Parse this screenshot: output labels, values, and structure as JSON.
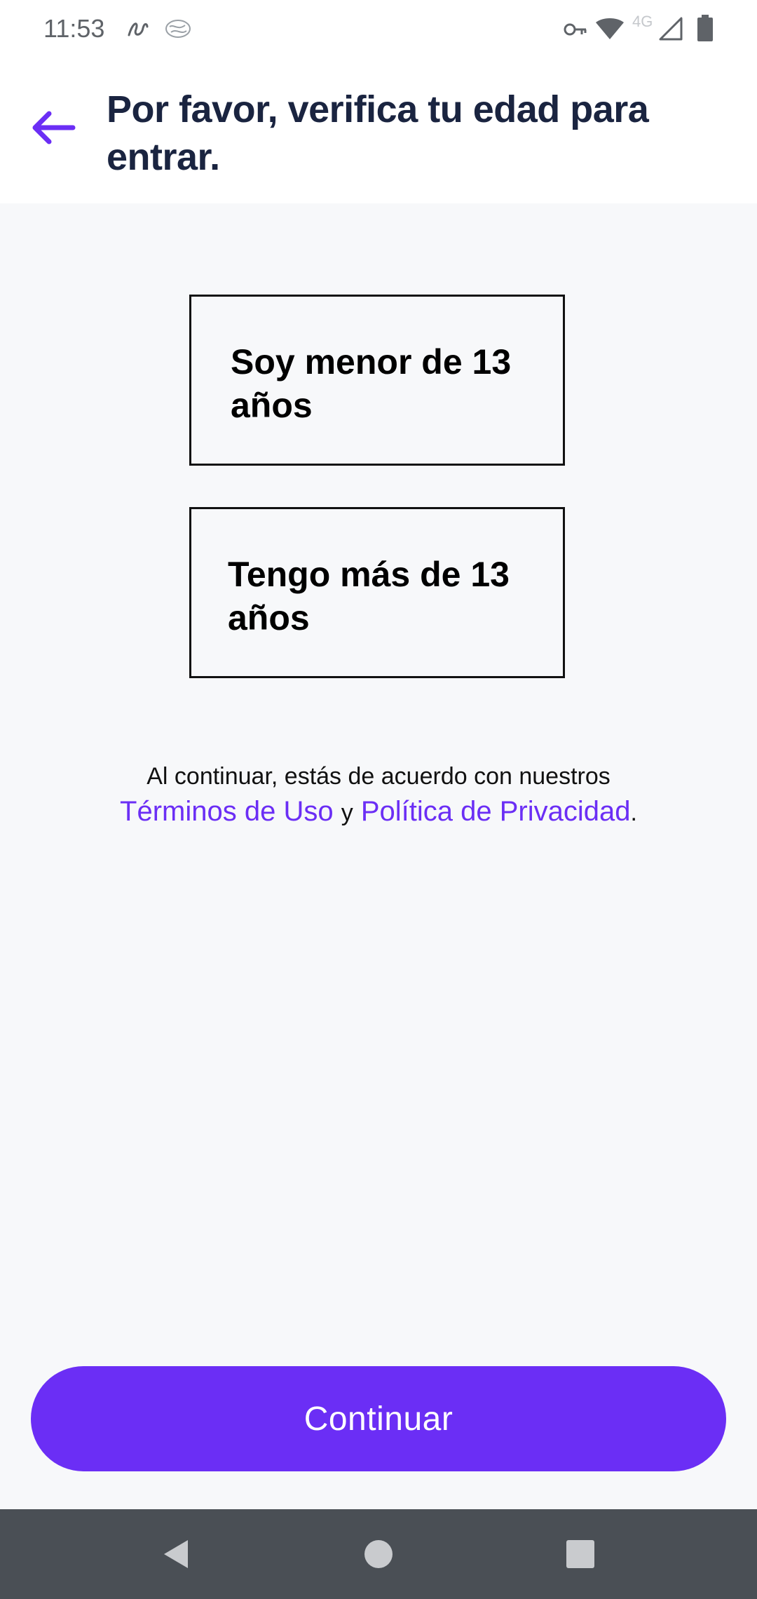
{
  "status_bar": {
    "time": "11:53",
    "network_label": "4G",
    "icons": [
      "notification-squiggle-icon",
      "notification-brain-icon",
      "vpn-key-icon",
      "wifi-icon",
      "cell-signal-icon",
      "battery-icon"
    ]
  },
  "header": {
    "back_icon": "arrow-left-icon",
    "title": "Por favor, verifica tu edad para entrar."
  },
  "options": [
    {
      "label": "Soy menor de 13 años"
    },
    {
      "label": "Tengo más de 13 años"
    }
  ],
  "legal": {
    "prefix": "Al continuar, estás de acuerdo con nuestros",
    "terms_link": "Términos de Uso",
    "conjunction": "y",
    "privacy_link": "Política de Privacidad",
    "suffix": "."
  },
  "continue_button": {
    "label": "Continuar"
  },
  "colors": {
    "accent": "#6b2ef5",
    "title": "#1a2440",
    "background": "#f7f8fa",
    "nav_bar": "#4a4f55"
  },
  "nav_bar": {
    "icons": [
      "back-triangle-icon",
      "home-circle-icon",
      "recents-square-icon"
    ]
  }
}
